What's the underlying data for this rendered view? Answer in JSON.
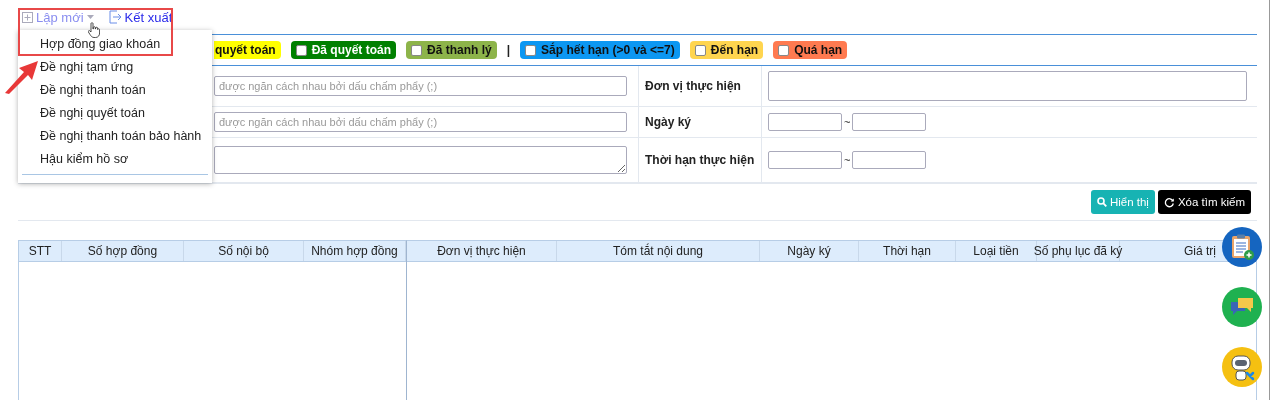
{
  "toolbar": {
    "buttons": [
      {
        "label": "Lập mới",
        "kind": "dropdown",
        "expanded": true
      },
      {
        "label": "Kết xuất",
        "kind": "export"
      }
    ]
  },
  "menu": {
    "items": [
      "Hợp đồng giao khoán",
      "Đề nghị tạm ứng",
      "Đề nghị thanh toán",
      "Đề nghị quyết toán",
      "Đề nghị thanh toán bảo hành",
      "Hậu kiểm hồ sơ"
    ]
  },
  "filters": [
    {
      "kind": "chip",
      "label": "quyết toán",
      "color": "#ffff00"
    },
    {
      "kind": "chip",
      "label": "Đã quyết toán",
      "color": "#008000",
      "checked": false
    },
    {
      "kind": "chip",
      "label": "Đã thanh lý",
      "color": "#8db44a",
      "checked": false
    },
    {
      "kind": "separator",
      "label": "|"
    },
    {
      "kind": "chip",
      "label": "Sắp hết hạn (>0 và <=7)",
      "color": "#0c97f2",
      "checked": false
    },
    {
      "kind": "chip",
      "label": "Đến hạn",
      "color": "#ffd54f",
      "checked": false
    },
    {
      "kind": "chip",
      "label": "Quá hạn",
      "color": "#ff7a50",
      "checked": false
    }
  ],
  "form": {
    "rows": [
      {
        "search": {
          "kind": "input",
          "placeholder": "được ngăn cách nhau bởi dấu chấm phẩy (;)"
        },
        "label": "Đơn vị thực hiện",
        "kind": "text"
      },
      {
        "search": {
          "kind": "input",
          "placeholder": "được ngăn cách nhau bởi dấu chấm phẩy (;)"
        },
        "label": "Ngày ký",
        "kind": "range",
        "separator": "~"
      },
      {
        "search": {
          "kind": "textarea"
        },
        "label": "Thời hạn thực hiện",
        "kind": "range",
        "separator": "~"
      }
    ]
  },
  "actions": [
    {
      "label": "Hiển thị",
      "kind": "search"
    },
    {
      "label": "Xóa tìm kiếm",
      "kind": "clear"
    }
  ],
  "table": {
    "frozen_columns": [
      "STT",
      "Số hợp đồng",
      "Số nội bộ",
      "Nhóm hợp đồng"
    ],
    "columns": [
      "Đơn vị thực hiện",
      "Tóm tắt nội dung",
      "Ngày ký",
      "Thời hạn",
      "Loại tiền",
      "Số phụ lục đã ký",
      "Giá trị"
    ]
  }
}
